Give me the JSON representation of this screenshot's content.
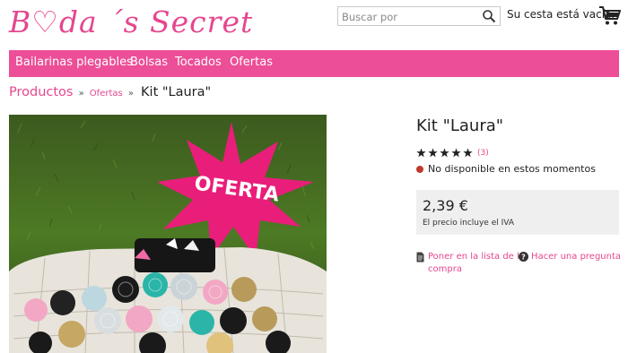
{
  "brand": {
    "name": "B♡da ´s Secret",
    "color": "#e5478f"
  },
  "search": {
    "placeholder": "Buscar por",
    "icon": "search-icon"
  },
  "cart": {
    "status": "Su cesta está vacía.",
    "icon": "shopping-cart-icon"
  },
  "nav": {
    "background": "#ec4e97",
    "items": [
      {
        "label": "Bailarinas plegables"
      },
      {
        "label": "Bolsas"
      },
      {
        "label": "Tocados"
      },
      {
        "label": "Ofertas"
      }
    ]
  },
  "breadcrumb": {
    "root": "Productos",
    "separator": "»",
    "category": "Ofertas",
    "current": "Kit \"Laura\""
  },
  "product": {
    "title": "Kit \"Laura\"",
    "rating": {
      "stars": 5,
      "count_label": "(3)"
    },
    "availability": "No disponible en estos momentos",
    "availability_color": "#c0392b",
    "price": "2,39 €",
    "vat_note": "El precio incluye el IVA",
    "image_badge": "OFERTA",
    "image_badge_color": "#e91e7a"
  },
  "actions": {
    "wishlist_line1": "Poner en la lista de la",
    "wishlist_line2": "compra",
    "wishlist_icon": "document-icon",
    "question": "Hacer una pregunta",
    "question_icon": "question-icon"
  }
}
